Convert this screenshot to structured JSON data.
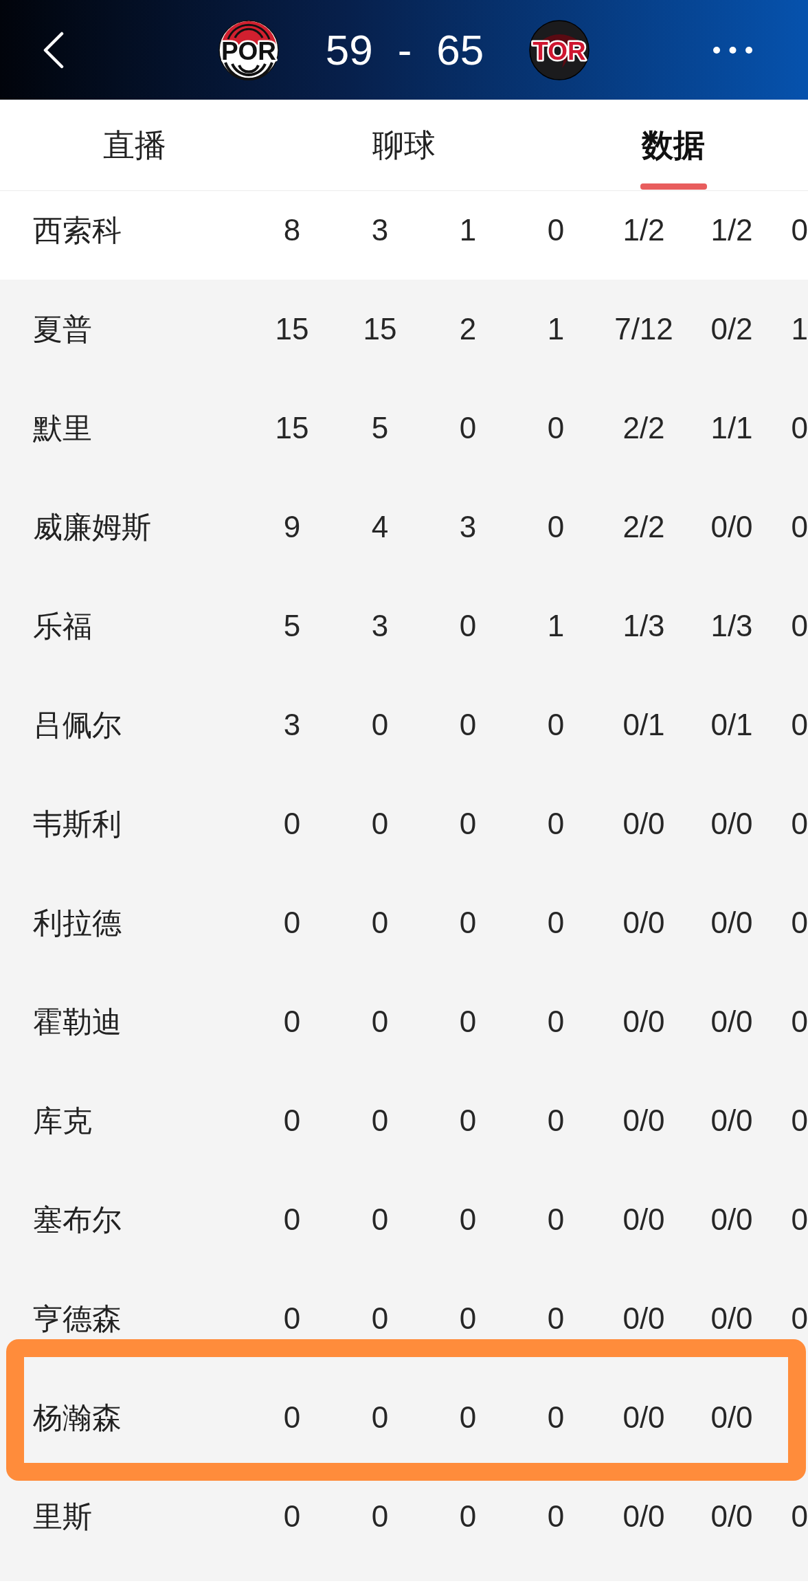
{
  "header": {
    "home_team": "POR",
    "score": {
      "home": "59",
      "separator": "-",
      "away": "65"
    },
    "away_team": "TOR"
  },
  "tabs": [
    {
      "label": "直播",
      "selected": false
    },
    {
      "label": "聊球",
      "selected": false
    },
    {
      "label": "数据",
      "selected": true
    }
  ],
  "row_groups": [
    {
      "rows": [
        {
          "name": "西索科",
          "highlighted": false,
          "stats": [
            "8",
            "3",
            "1",
            "0",
            "1/2",
            "1/2",
            "0"
          ]
        }
      ]
    },
    {
      "rows": [
        {
          "name": "夏普",
          "highlighted": false,
          "stats": [
            "15",
            "15",
            "2",
            "1",
            "7/12",
            "0/2",
            "1"
          ]
        },
        {
          "name": "默里",
          "highlighted": false,
          "stats": [
            "15",
            "5",
            "0",
            "0",
            "2/2",
            "1/1",
            "0"
          ]
        },
        {
          "name": "威廉姆斯",
          "highlighted": false,
          "stats": [
            "9",
            "4",
            "3",
            "0",
            "2/2",
            "0/0",
            "0"
          ]
        },
        {
          "name": "乐福",
          "highlighted": false,
          "stats": [
            "5",
            "3",
            "0",
            "1",
            "1/3",
            "1/3",
            "0"
          ]
        },
        {
          "name": "吕佩尔",
          "highlighted": false,
          "stats": [
            "3",
            "0",
            "0",
            "0",
            "0/1",
            "0/1",
            "0"
          ]
        },
        {
          "name": "韦斯利",
          "highlighted": false,
          "stats": [
            "0",
            "0",
            "0",
            "0",
            "0/0",
            "0/0",
            "0"
          ]
        },
        {
          "name": "利拉德",
          "highlighted": false,
          "stats": [
            "0",
            "0",
            "0",
            "0",
            "0/0",
            "0/0",
            "0"
          ]
        },
        {
          "name": "霍勒迪",
          "highlighted": false,
          "stats": [
            "0",
            "0",
            "0",
            "0",
            "0/0",
            "0/0",
            "0"
          ]
        },
        {
          "name": "库克",
          "highlighted": false,
          "stats": [
            "0",
            "0",
            "0",
            "0",
            "0/0",
            "0/0",
            "0"
          ]
        },
        {
          "name": "塞布尔",
          "highlighted": false,
          "stats": [
            "0",
            "0",
            "0",
            "0",
            "0/0",
            "0/0",
            "0"
          ]
        },
        {
          "name": "亨德森",
          "highlighted": false,
          "stats": [
            "0",
            "0",
            "0",
            "0",
            "0/0",
            "0/0",
            "0"
          ]
        },
        {
          "name": "杨瀚森",
          "highlighted": true,
          "stats": [
            "0",
            "0",
            "0",
            "0",
            "0/0",
            "0/0"
          ]
        },
        {
          "name": "里斯",
          "highlighted": false,
          "stats": [
            "0",
            "0",
            "0",
            "0",
            "0/0",
            "0/0",
            "0"
          ]
        }
      ]
    }
  ]
}
